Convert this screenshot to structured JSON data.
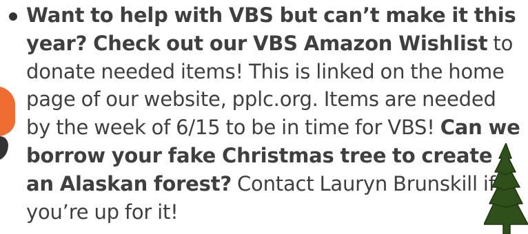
{
  "bullet": {
    "bold_1": "Want to help with VBS but can’t make it this year? Check out our VBS Amazon Wishlist",
    "text_1": " to donate needed items! This is linked on the home page of our website, pplc.org. Items are needed by the week of 6/15 to be in time for VBS! ",
    "bold_2": "Can we borrow your fake Christmas tree to create an Alaskan forest?",
    "text_2": " Contact Lauryn Brunskill if you’re up for it!"
  },
  "decorations": {
    "left_icon": "orange-ornament-icon",
    "right_icon": "pine-tree-icon",
    "colors": {
      "orange": "#ef6c32",
      "tree_green": "#2f4f1b",
      "dark": "#333333",
      "text": "#3f3f3f"
    }
  }
}
